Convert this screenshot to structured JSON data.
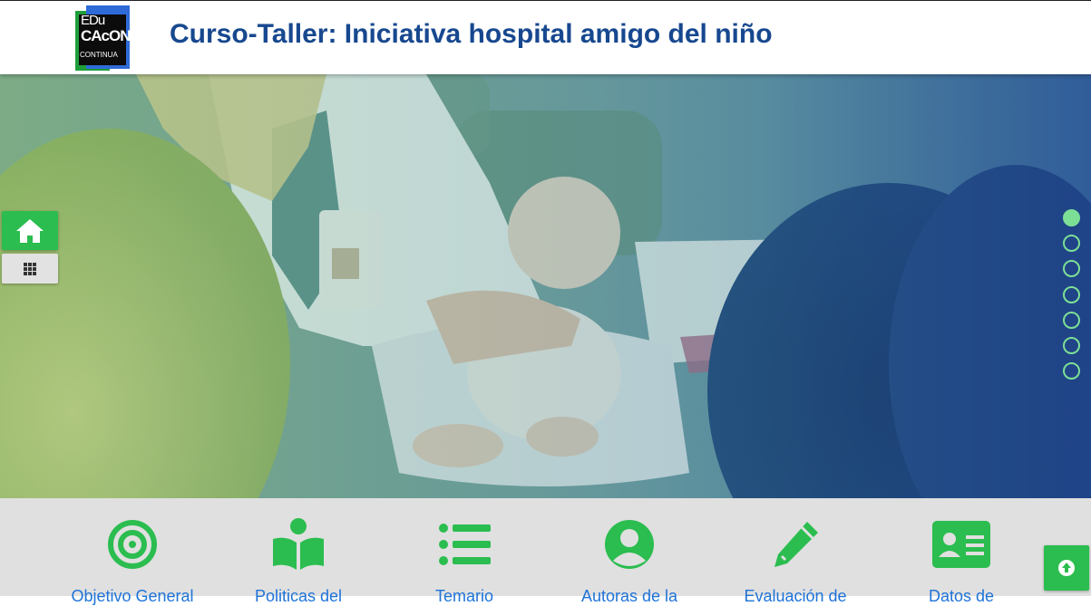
{
  "header": {
    "logo": {
      "line1": "EDu",
      "line2": "CAcON",
      "line3": "CONTINUA"
    },
    "title": "Curso-Taller: Iniciativa hospital amigo del niño"
  },
  "hero": {
    "slides_total": 7,
    "active_slide": 1
  },
  "sidebar": {
    "home_icon": "home-icon",
    "grid_icon": "grid-icon"
  },
  "menu": {
    "items": [
      {
        "label": "Objetivo General",
        "icon": "target-icon"
      },
      {
        "label": "Politicas del",
        "icon": "open-book-icon"
      },
      {
        "label": "Temario",
        "icon": "list-icon"
      },
      {
        "label": "Autoras de la",
        "icon": "user-circle-icon"
      },
      {
        "label": "Evaluación de",
        "icon": "pencil-icon"
      },
      {
        "label": "Datos de",
        "icon": "id-card-icon"
      }
    ]
  },
  "back_to_top": {
    "icon": "arrow-up-circle-icon"
  },
  "colors": {
    "title": "#17488f",
    "accent_green": "#2bbd4f",
    "link_blue": "#1e73d8",
    "menu_bg": "#e0e0e0"
  }
}
